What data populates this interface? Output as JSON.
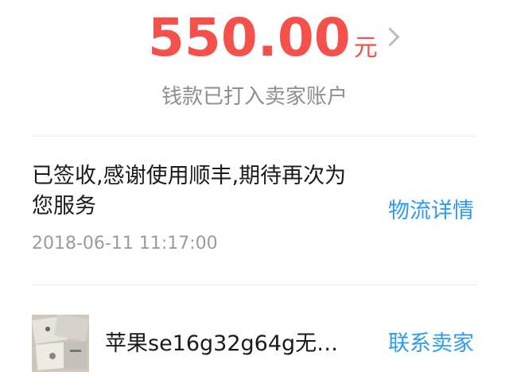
{
  "payment": {
    "amount": "550.00",
    "currency": "元",
    "status": "钱款已打入卖家账户"
  },
  "logistics": {
    "message": "已签收,感谢使用顺丰,期待再次为您服务",
    "timestamp": "2018-06-11 11:17:00",
    "details_link": "物流详情"
  },
  "product": {
    "name": "苹果se16g32g64g无…",
    "contact_seller_link": "联系卖家"
  },
  "colors": {
    "amount": "#f5504a",
    "link": "#2d9bf0",
    "muted": "#9b9b9b"
  }
}
